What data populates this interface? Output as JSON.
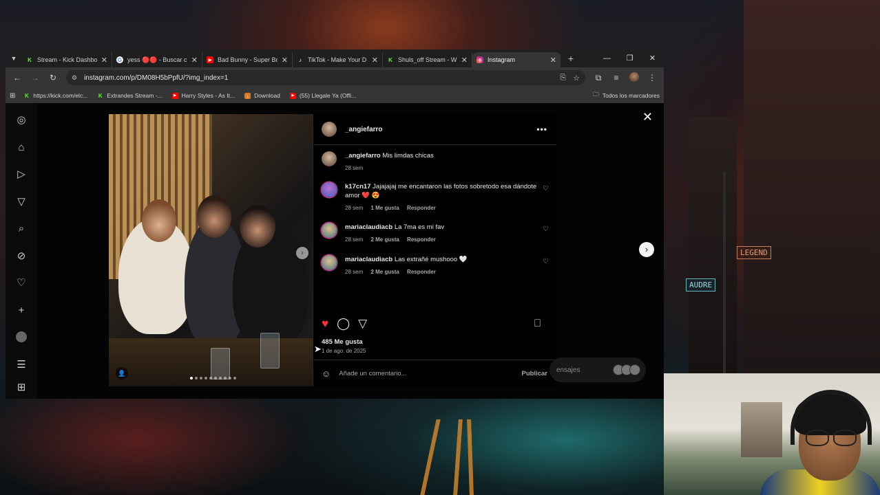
{
  "browser": {
    "tabs": [
      {
        "title": "Stream - Kick Dashbo",
        "favicon": "kick-icon",
        "color": "#53fc18",
        "active": false
      },
      {
        "title": "yess 🔴🔴 - Buscar c",
        "favicon": "google-icon",
        "color": "#ffffff",
        "active": false
      },
      {
        "title": "Bad Bunny - Super Bo",
        "favicon": "youtube-icon",
        "color": "#ff0000",
        "active": false
      },
      {
        "title": "TikTok - Make Your D",
        "favicon": "tiktok-icon",
        "color": "#ffffff",
        "active": false
      },
      {
        "title": "Shuls_off Stream - W",
        "favicon": "kick-icon",
        "color": "#53fc18",
        "active": false
      },
      {
        "title": "Instagram",
        "favicon": "instagram-icon",
        "color": "#e1306c",
        "active": true
      }
    ],
    "url": "instagram.com/p/DM08H5bPpfU/?img_index=1",
    "bookmarks": [
      {
        "label": "https://kick.com/elc...",
        "favicon": "kick-icon"
      },
      {
        "label": "Extrandes Stream -...",
        "favicon": "kick-icon"
      },
      {
        "label": "Harry Styles - As It...",
        "favicon": "youtube-icon"
      },
      {
        "label": "Download",
        "favicon": "download-icon"
      },
      {
        "label": "(55) Llegale Ya (Offi...",
        "favicon": "youtube-icon"
      }
    ],
    "all_bookmarks_label": "Todos los marcadores"
  },
  "post": {
    "username": "_angiefarro",
    "caption_user": "_angiefarro",
    "caption_text": "Mis limdas chicas",
    "caption_time": "28 sem",
    "comments": [
      {
        "user": "k17cn17",
        "text": "Jajajajaj me encantaron las fotos sobretodo esa dándote amor ❤️ 😍",
        "time": "28 sem",
        "likes": "1 Me gusta",
        "reply": "Responder"
      },
      {
        "user": "mariaclaudiacb",
        "text": "La 7ma es mi fav",
        "time": "28 sem",
        "likes": "2 Me gusta",
        "reply": "Responder"
      },
      {
        "user": "mariaclaudiacb",
        "text": "Las extrañé mushooo 🤍",
        "time": "28 sem",
        "likes": "2 Me gusta",
        "reply": "Responder"
      }
    ],
    "likes_count": "485 Me gusta",
    "date": "1 de ago. de 2025",
    "add_comment_placeholder": "Añade un comentario...",
    "publish_label": "Publicar",
    "messages_label": "ensajes"
  },
  "colors": {
    "heart_liked": "#ff3040",
    "instagram_bg": "#000000"
  }
}
